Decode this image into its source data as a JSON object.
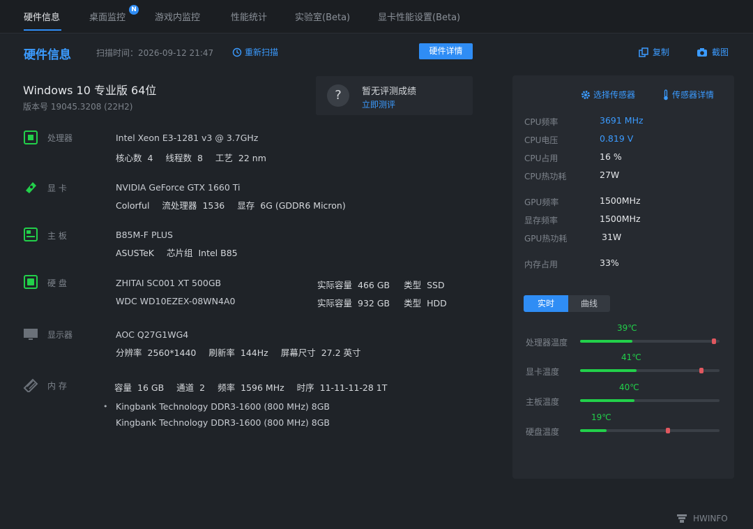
{
  "tabs": [
    {
      "label": "硬件信息"
    },
    {
      "label": "桌面监控",
      "badge": "N"
    },
    {
      "label": "游戏内监控"
    },
    {
      "label": "性能统计"
    },
    {
      "label": "实验室(Beta)"
    },
    {
      "label": "显卡性能设置(Beta)"
    }
  ],
  "header": {
    "title": "硬件信息",
    "scan_time": "扫描时间：2026-09-12 21:47",
    "rescan": "重新扫描",
    "detail_button": "硬件详情",
    "copy": "复制",
    "screenshot": "截图"
  },
  "os": {
    "name": "Windows 10 专业版 64位",
    "build": "版本号  19045.3208 (22H2)"
  },
  "benchmark": {
    "icon": "?",
    "title": "暂无评测成绩",
    "link": "立即测评"
  },
  "hardware": {
    "cpu": {
      "label": "处理器",
      "model": "Intel Xeon E3-1281 v3 @ 3.7GHz",
      "cores_k": "核心数",
      "cores_v": "4",
      "threads_k": "线程数",
      "threads_v": "8",
      "process_k": "工艺",
      "process_v": "22 nm"
    },
    "gpu": {
      "label": "显  卡",
      "model": "NVIDIA GeForce GTX 1660 Ti",
      "vendor": "Colorful",
      "shaders_k": "流处理器",
      "shaders_v": "1536",
      "vram_k": "显存",
      "vram_v": "6G (GDDR6 Micron)"
    },
    "board": {
      "label": "主  板",
      "model": "B85M-F PLUS",
      "vendor": "ASUSTeK",
      "chipset_k": "芯片组",
      "chipset_v": "Intel B85"
    },
    "disk": {
      "label": "硬  盘",
      "drives": [
        {
          "model": "ZHITAI SC001 XT 500GB",
          "cap_k": "实际容量",
          "cap_v": "466 GB",
          "type_k": "类型",
          "type_v": "SSD"
        },
        {
          "model": "WDC WD10EZEX-08WN4A0",
          "cap_k": "实际容量",
          "cap_v": "932 GB",
          "type_k": "类型",
          "type_v": "HDD"
        }
      ]
    },
    "monitor": {
      "label": "显示器",
      "model": "AOC Q27G1WG4",
      "res_k": "分辨率",
      "res_v": "2560*1440",
      "refresh_k": "刷新率",
      "refresh_v": "144Hz",
      "size_k": "屏幕尺寸",
      "size_v": "27.2 英寸"
    },
    "memory": {
      "label": "内  存",
      "cap_k": "容量",
      "cap_v": "16 GB",
      "ch_k": "通道",
      "ch_v": "2",
      "freq_k": "频率",
      "freq_v": "1596 MHz",
      "timing_k": "时序",
      "timing_v": "11-11-11-28 1T",
      "bullet": "•",
      "sticks": [
        "Kingbank Technology DDR3-1600 (800 MHz) 8GB",
        "Kingbank Technology DDR3-1600 (800 MHz) 8GB"
      ]
    }
  },
  "panel": {
    "select_sensor": "选择传感器",
    "sensor_detail": "传感器详情",
    "stats": [
      {
        "label": "CPU频率",
        "value": "3691 MHz",
        "color": "blue"
      },
      {
        "label": "CPU电压",
        "value": "0.819 V",
        "color": "blue"
      },
      {
        "label": "CPU占用",
        "value": "16 %",
        "color": "white"
      },
      {
        "label": "CPU热功耗",
        "value": "27W",
        "color": "white"
      },
      {
        "label": "GPU频率",
        "value": "1500MHz",
        "color": "white"
      },
      {
        "label": "显存频率",
        "value": "1500MHz",
        "color": "white"
      },
      {
        "label": "GPU热功耗",
        "value": "31W",
        "color": "white"
      },
      {
        "label": "内存占用",
        "value": "33%",
        "color": "white"
      }
    ],
    "seg_realtime": "实时",
    "seg_curve": "曲线",
    "temps": [
      {
        "label": "处理器温度",
        "value": "39℃",
        "level": 0.375,
        "max": 0.96
      },
      {
        "label": "显卡温度",
        "value": "41℃",
        "level": 0.405,
        "max": 0.87
      },
      {
        "label": "主板温度",
        "value": "40℃",
        "level": 0.39,
        "max": null
      },
      {
        "label": "硬盘温度",
        "value": "19℃",
        "level": 0.19,
        "max": 0.63
      }
    ]
  },
  "footer": {
    "brand": "HWINFO"
  },
  "colors": {
    "accent": "#2f8df5",
    "temp_ok": "#22d04a",
    "temp_max": "#e0585f"
  }
}
